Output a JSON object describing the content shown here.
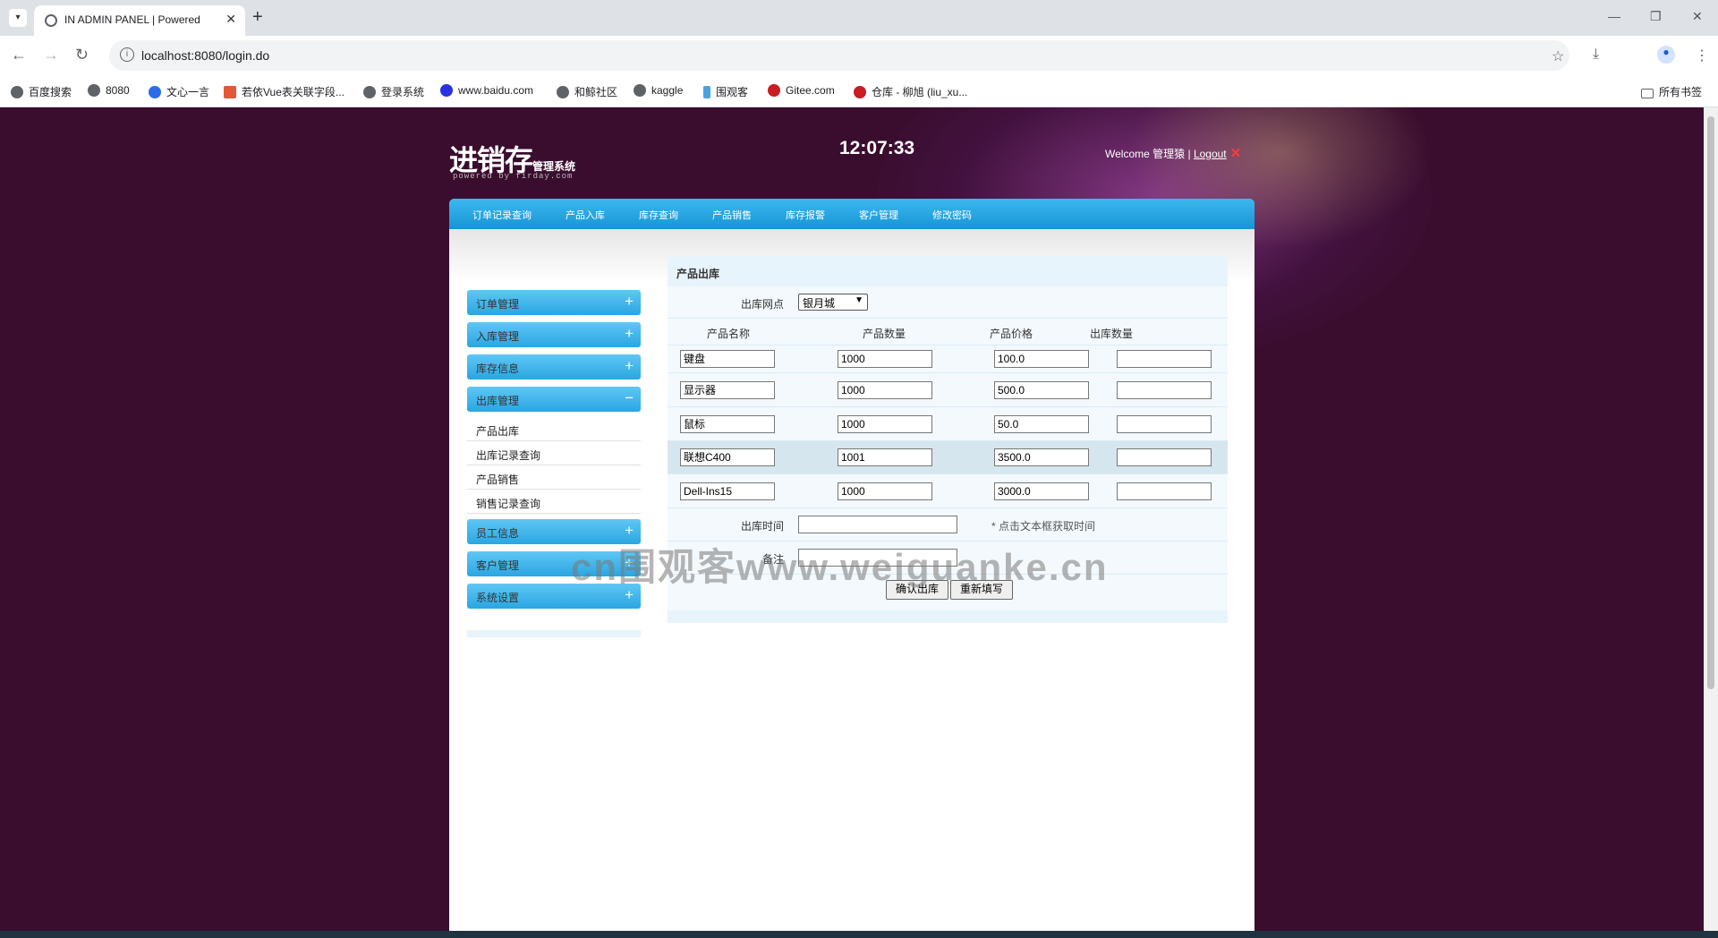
{
  "browser": {
    "tab_title": "IN ADMIN PANEL | Powered",
    "url": "localhost:8080/login.do",
    "bookmarks": [
      "百度搜索",
      "8080",
      "文心一言",
      "若依Vue表关联字段...",
      "登录系统",
      "www.baidu.com",
      "和鲸社区",
      "kaggle",
      "围观客",
      "Gitee.com",
      "仓库 - 柳旭 (liu_xu...",
      "所有书签"
    ]
  },
  "header": {
    "logo_big": "进销存",
    "logo_small": "管理系统",
    "powered": "powered by firday.com",
    "clock": "12:07:33",
    "welcome": "Welcome 管理猿 |",
    "logout": "Logout"
  },
  "topnav": [
    "订单记录查询",
    "产品入库",
    "库存查询",
    "产品销售",
    "库存报警",
    "客户管理",
    "修改密码"
  ],
  "sidebar": {
    "groups": [
      "订单管理",
      "入库管理",
      "库存信息",
      "出库管理",
      "员工信息",
      "客户管理",
      "系统设置"
    ],
    "signs": [
      "+",
      "+",
      "+",
      "−",
      "+",
      "+",
      "+"
    ],
    "sub_items": [
      "产品出库",
      "出库记录查询",
      "产品销售",
      "销售记录查询"
    ]
  },
  "form": {
    "title": "产品出库",
    "outlet_label": "出库网点",
    "outlet_value": "银月城",
    "columns": [
      "产品名称",
      "产品数量",
      "产品价格",
      "出库数量"
    ],
    "rows": [
      {
        "name": "键盘",
        "qty": "1000",
        "price": "100.0",
        "out": ""
      },
      {
        "name": "显示器",
        "qty": "1000",
        "price": "500.0",
        "out": ""
      },
      {
        "name": "鼠标",
        "qty": "1000",
        "price": "50.0",
        "out": ""
      },
      {
        "name": "联想C400",
        "qty": "1001",
        "price": "3500.0",
        "out": ""
      },
      {
        "name": "Dell-Ins15",
        "qty": "1000",
        "price": "3000.0",
        "out": ""
      }
    ],
    "time_label": "出库时间",
    "time_hint": "* 点击文本框获取时间",
    "note_label": "备注",
    "submit": "确认出库",
    "reset": "重新填写"
  },
  "watermark": "cn围观客www.weiguanke.cn"
}
